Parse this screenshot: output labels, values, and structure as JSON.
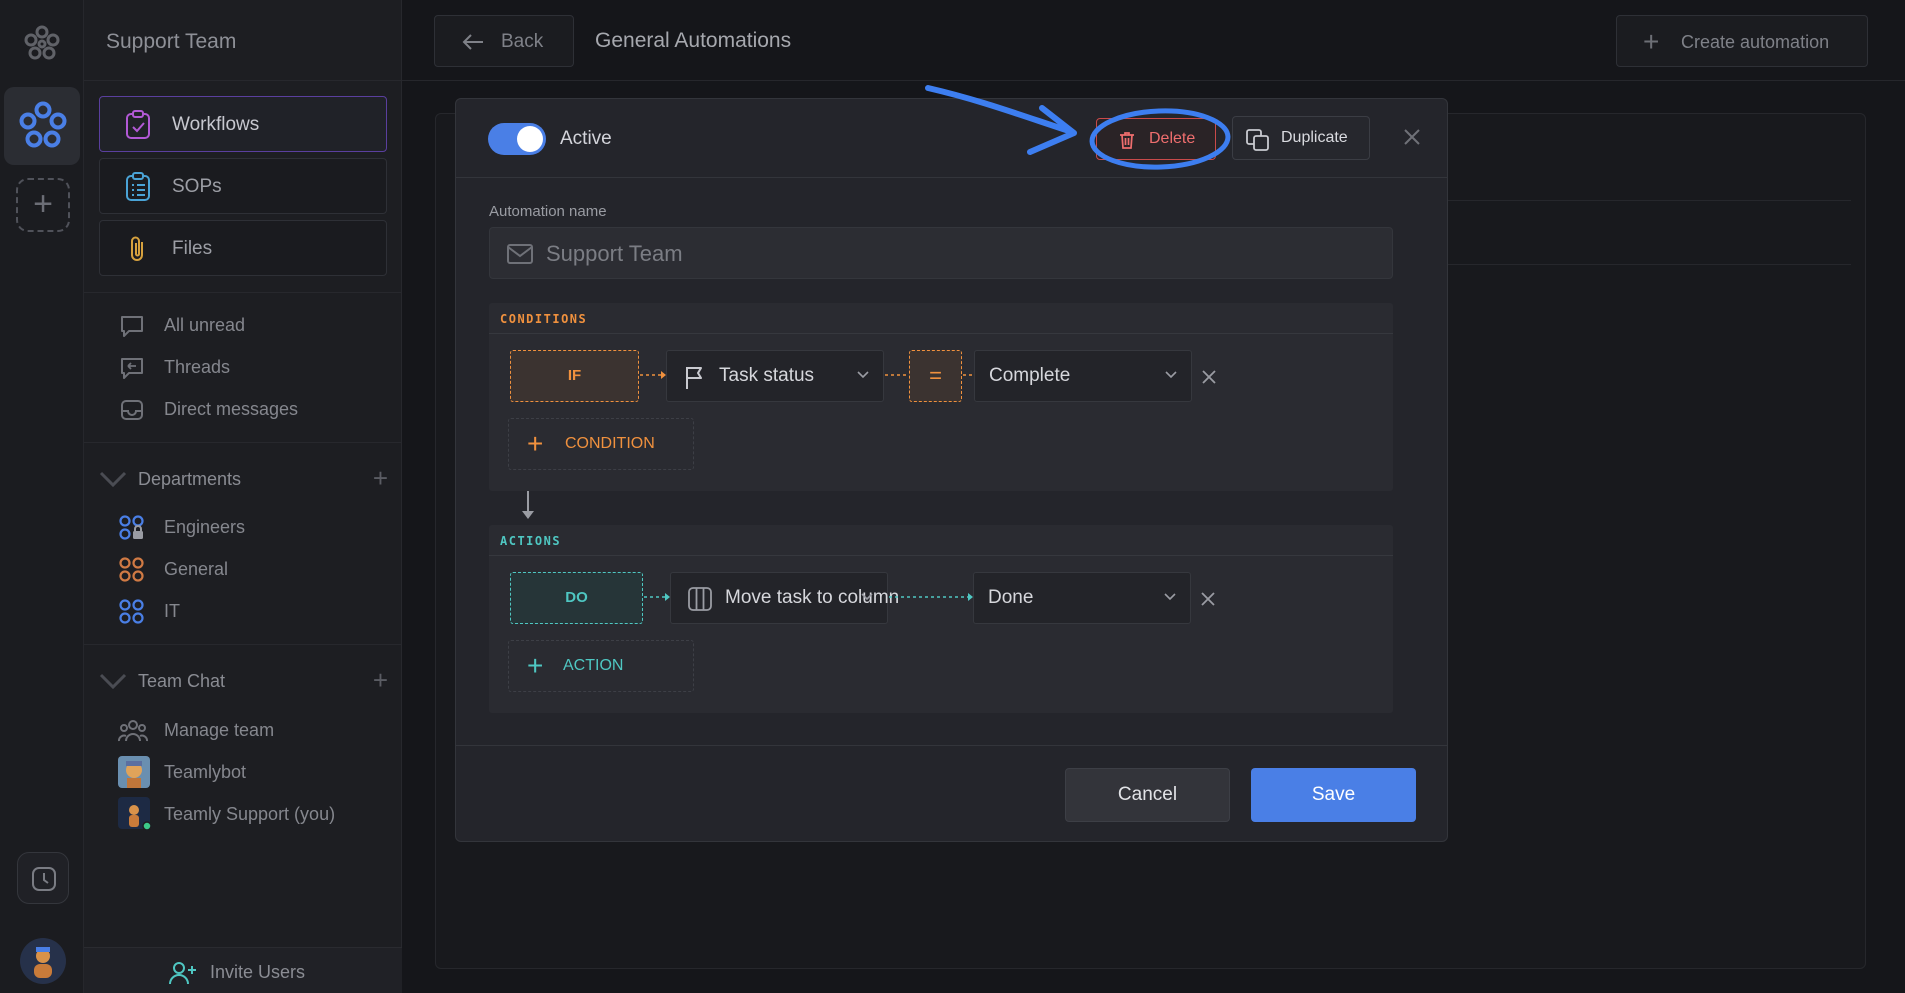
{
  "workspace": {
    "title": "Support Team"
  },
  "sidebar": {
    "cards": [
      {
        "label": "Workflows",
        "icon": "clipboard-check-icon",
        "active": true
      },
      {
        "label": "SOPs",
        "icon": "list-doc-icon",
        "active": false
      },
      {
        "label": "Files",
        "icon": "paperclip-icon",
        "active": false
      }
    ],
    "inbox": [
      {
        "label": "All unread",
        "icon": "chat-bubble-icon"
      },
      {
        "label": "Threads",
        "icon": "thread-icon"
      },
      {
        "label": "Direct messages",
        "icon": "inbox-icon"
      }
    ],
    "departments": {
      "title": "Departments",
      "items": [
        {
          "label": "Engineers",
          "icon": "engineers-icon"
        },
        {
          "label": "General",
          "icon": "general-icon"
        },
        {
          "label": "IT",
          "icon": "it-icon"
        }
      ]
    },
    "team_chat": {
      "title": "Team Chat",
      "items": [
        {
          "label": "Manage team",
          "icon": "team-icon"
        },
        {
          "label": "Teamlybot",
          "icon": "bot-avatar"
        },
        {
          "label": "Teamly Support (you)",
          "icon": "user-avatar"
        }
      ]
    },
    "invite_label": "Invite Users"
  },
  "header": {
    "back_label": "Back",
    "title": "General Automations",
    "create_label": "Create automation"
  },
  "modal": {
    "active_label": "Active",
    "active": true,
    "delete_label": "Delete",
    "duplicate_label": "Duplicate",
    "name_label": "Automation name",
    "name_value": "Support Team",
    "conditions": {
      "title": "CONDITIONS",
      "if_label": "IF",
      "field": "Task status",
      "operator": "=",
      "value": "Complete",
      "add_label": "CONDITION"
    },
    "actions": {
      "title": "ACTIONS",
      "do_label": "DO",
      "action": "Move task to column",
      "value": "Done",
      "add_label": "ACTION"
    },
    "cancel_label": "Cancel",
    "save_label": "Save"
  },
  "colors": {
    "accent": "#4a7fe6",
    "danger": "#ef6e6e",
    "condition": "#f0913e",
    "action": "#4fc7c2",
    "annotation": "#3d7ef0"
  }
}
